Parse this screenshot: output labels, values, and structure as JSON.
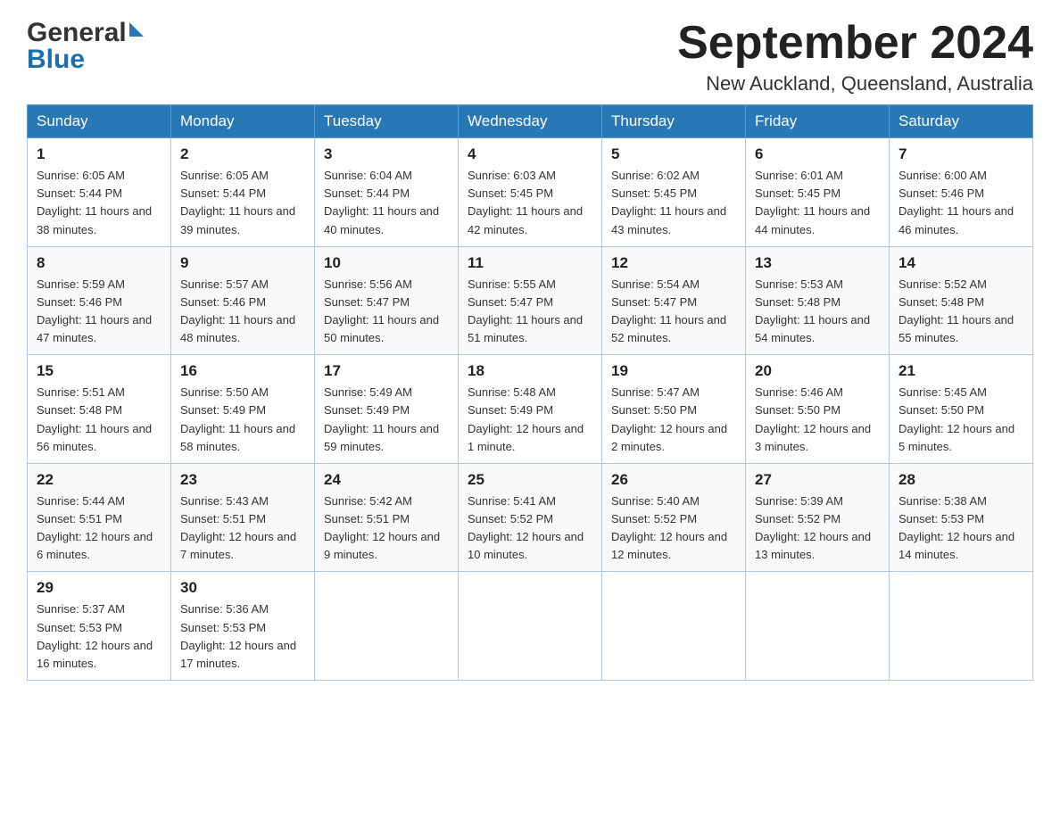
{
  "header": {
    "logo_line1": "General",
    "logo_line2": "Blue",
    "month_title": "September 2024",
    "location": "New Auckland, Queensland, Australia"
  },
  "weekdays": [
    "Sunday",
    "Monday",
    "Tuesday",
    "Wednesday",
    "Thursday",
    "Friday",
    "Saturday"
  ],
  "weeks": [
    [
      {
        "day": "1",
        "sunrise": "6:05 AM",
        "sunset": "5:44 PM",
        "daylight": "11 hours and 38 minutes."
      },
      {
        "day": "2",
        "sunrise": "6:05 AM",
        "sunset": "5:44 PM",
        "daylight": "11 hours and 39 minutes."
      },
      {
        "day": "3",
        "sunrise": "6:04 AM",
        "sunset": "5:44 PM",
        "daylight": "11 hours and 40 minutes."
      },
      {
        "day": "4",
        "sunrise": "6:03 AM",
        "sunset": "5:45 PM",
        "daylight": "11 hours and 42 minutes."
      },
      {
        "day": "5",
        "sunrise": "6:02 AM",
        "sunset": "5:45 PM",
        "daylight": "11 hours and 43 minutes."
      },
      {
        "day": "6",
        "sunrise": "6:01 AM",
        "sunset": "5:45 PM",
        "daylight": "11 hours and 44 minutes."
      },
      {
        "day": "7",
        "sunrise": "6:00 AM",
        "sunset": "5:46 PM",
        "daylight": "11 hours and 46 minutes."
      }
    ],
    [
      {
        "day": "8",
        "sunrise": "5:59 AM",
        "sunset": "5:46 PM",
        "daylight": "11 hours and 47 minutes."
      },
      {
        "day": "9",
        "sunrise": "5:57 AM",
        "sunset": "5:46 PM",
        "daylight": "11 hours and 48 minutes."
      },
      {
        "day": "10",
        "sunrise": "5:56 AM",
        "sunset": "5:47 PM",
        "daylight": "11 hours and 50 minutes."
      },
      {
        "day": "11",
        "sunrise": "5:55 AM",
        "sunset": "5:47 PM",
        "daylight": "11 hours and 51 minutes."
      },
      {
        "day": "12",
        "sunrise": "5:54 AM",
        "sunset": "5:47 PM",
        "daylight": "11 hours and 52 minutes."
      },
      {
        "day": "13",
        "sunrise": "5:53 AM",
        "sunset": "5:48 PM",
        "daylight": "11 hours and 54 minutes."
      },
      {
        "day": "14",
        "sunrise": "5:52 AM",
        "sunset": "5:48 PM",
        "daylight": "11 hours and 55 minutes."
      }
    ],
    [
      {
        "day": "15",
        "sunrise": "5:51 AM",
        "sunset": "5:48 PM",
        "daylight": "11 hours and 56 minutes."
      },
      {
        "day": "16",
        "sunrise": "5:50 AM",
        "sunset": "5:49 PM",
        "daylight": "11 hours and 58 minutes."
      },
      {
        "day": "17",
        "sunrise": "5:49 AM",
        "sunset": "5:49 PM",
        "daylight": "11 hours and 59 minutes."
      },
      {
        "day": "18",
        "sunrise": "5:48 AM",
        "sunset": "5:49 PM",
        "daylight": "12 hours and 1 minute."
      },
      {
        "day": "19",
        "sunrise": "5:47 AM",
        "sunset": "5:50 PM",
        "daylight": "12 hours and 2 minutes."
      },
      {
        "day": "20",
        "sunrise": "5:46 AM",
        "sunset": "5:50 PM",
        "daylight": "12 hours and 3 minutes."
      },
      {
        "day": "21",
        "sunrise": "5:45 AM",
        "sunset": "5:50 PM",
        "daylight": "12 hours and 5 minutes."
      }
    ],
    [
      {
        "day": "22",
        "sunrise": "5:44 AM",
        "sunset": "5:51 PM",
        "daylight": "12 hours and 6 minutes."
      },
      {
        "day": "23",
        "sunrise": "5:43 AM",
        "sunset": "5:51 PM",
        "daylight": "12 hours and 7 minutes."
      },
      {
        "day": "24",
        "sunrise": "5:42 AM",
        "sunset": "5:51 PM",
        "daylight": "12 hours and 9 minutes."
      },
      {
        "day": "25",
        "sunrise": "5:41 AM",
        "sunset": "5:52 PM",
        "daylight": "12 hours and 10 minutes."
      },
      {
        "day": "26",
        "sunrise": "5:40 AM",
        "sunset": "5:52 PM",
        "daylight": "12 hours and 12 minutes."
      },
      {
        "day": "27",
        "sunrise": "5:39 AM",
        "sunset": "5:52 PM",
        "daylight": "12 hours and 13 minutes."
      },
      {
        "day": "28",
        "sunrise": "5:38 AM",
        "sunset": "5:53 PM",
        "daylight": "12 hours and 14 minutes."
      }
    ],
    [
      {
        "day": "29",
        "sunrise": "5:37 AM",
        "sunset": "5:53 PM",
        "daylight": "12 hours and 16 minutes."
      },
      {
        "day": "30",
        "sunrise": "5:36 AM",
        "sunset": "5:53 PM",
        "daylight": "12 hours and 17 minutes."
      },
      null,
      null,
      null,
      null,
      null
    ]
  ],
  "labels": {
    "sunrise": "Sunrise:",
    "sunset": "Sunset:",
    "daylight": "Daylight:"
  }
}
